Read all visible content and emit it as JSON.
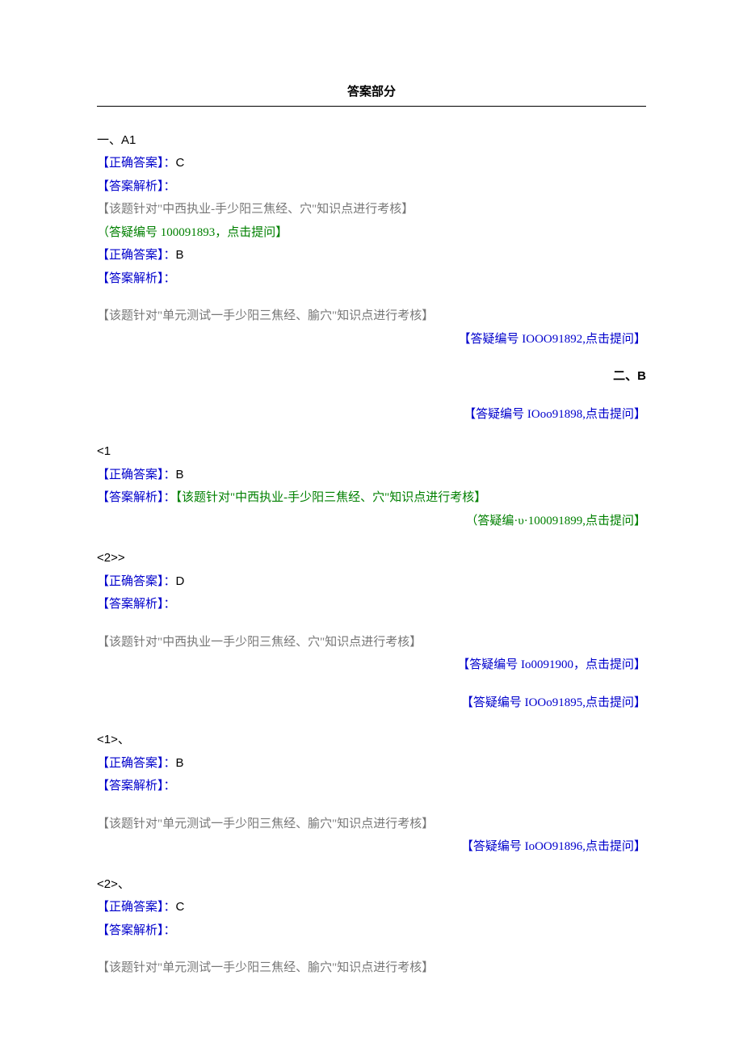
{
  "title": "答案部分",
  "s1": {
    "header": "一、A1",
    "a1": {
      "correct_label": "【正确答案】：",
      "correct_value": "C",
      "analysis_label": "【答案解析】：",
      "note": "【该题针对\"中西执业-手少阳三焦经、穴\"知识点进行考核】",
      "ask": "（答疑编号 100091893，点击提问】"
    },
    "a2": {
      "correct_label": "【正确答案】：",
      "correct_value": "B",
      "analysis_label": "【答案解析】：",
      "note": "【该题针对\"单元测试一手少阳三焦经、腧穴\"知识点进行考核】",
      "ask": "【答疑编号 IOOO91892,点击提问】"
    }
  },
  "s2": {
    "header": "二、B",
    "ask_top": "【答疑编号 IOoo91898,点击提问】",
    "q1": {
      "idx": "<1",
      "correct_label": "【正确答案】：",
      "correct_value": "B",
      "analysis_label": "【答案解析】：",
      "note": "【该题针对\"中西执业-手少阳三焦经、穴\"知识点进行考核】",
      "ask": "（答疑编·υ·100091899,点击提问】"
    },
    "q2": {
      "idx": "<2>>",
      "correct_label": "【正确答案】：",
      "correct_value": "D",
      "analysis_label": "【答案解析】：",
      "note": "【该题针对\"中西执业一手少阳三焦经、穴\"知识点进行考核】",
      "ask1": "【答疑编号 Io0091900，点击提问】",
      "ask2": "【答疑编号 IOOo91895,点击提问】"
    },
    "q3": {
      "idx": "<1>、",
      "correct_label": "【正确答案】：",
      "correct_value": "B",
      "analysis_label": "【答案解析】：",
      "note": "【该题针对\"单元测试一手少阳三焦经、腧穴\"知识点进行考核】",
      "ask": "【答疑编号 IoOO91896,点击提问】"
    },
    "q4": {
      "idx": "<2>、",
      "correct_label": "【正确答案】：",
      "correct_value": "C",
      "analysis_label": "【答案解析】：",
      "note": "【该题针对\"单元测试一手少阳三焦经、腧穴\"知识点进行考核】"
    }
  }
}
